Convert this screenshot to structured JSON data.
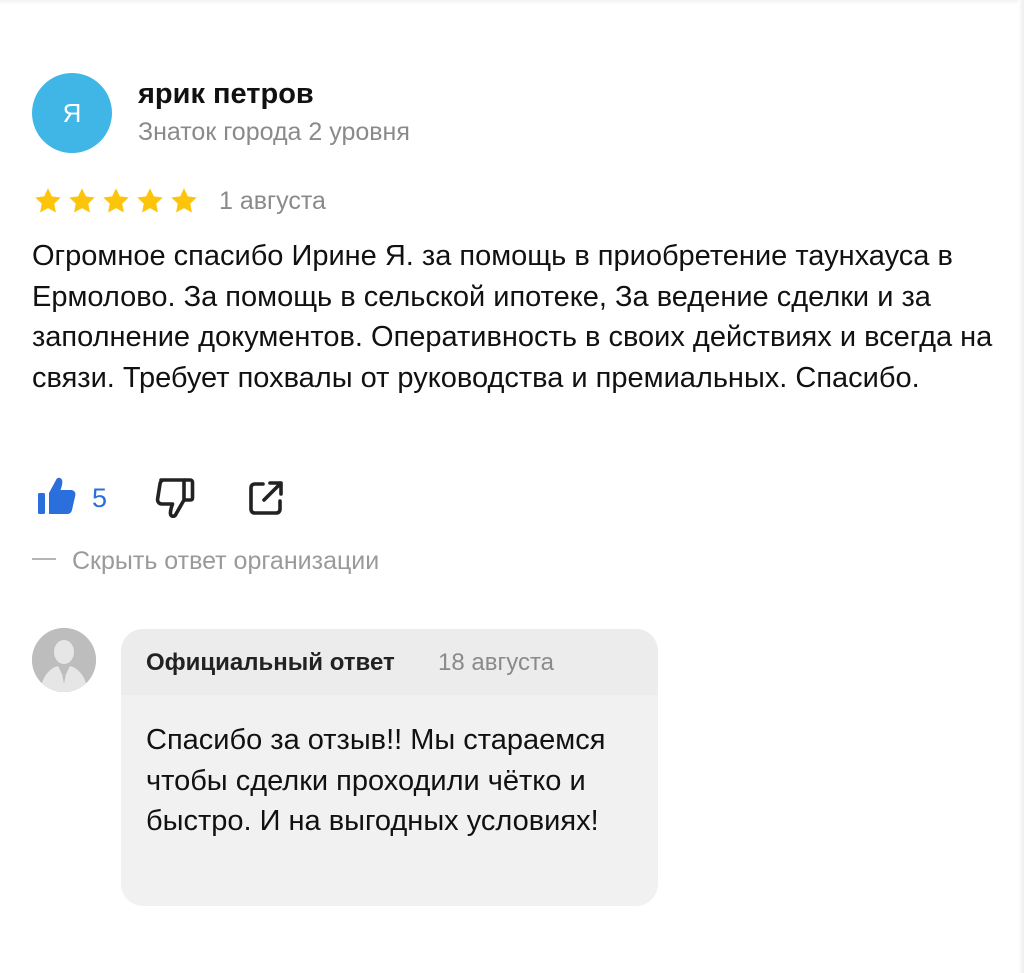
{
  "review": {
    "author": {
      "initial": "Я",
      "name": "ярик петров",
      "level": "Знаток города 2 уровня",
      "avatar_color": "#3fb6e6"
    },
    "rating": 5,
    "star_color": "#fcc50b",
    "date": "1 августа",
    "text": "Огромное спасибо Ирине Я. за помощь в приобретение таунхауса в Ермолово. За помощь в сельской ипотеке, За ведение сделки и за заполнение документов. Оперативность в своих действиях и всегда на связи. Требует похвалы от руководства и премиальных. Спасибо."
  },
  "actions": {
    "like_icon": "thumbs-up-icon",
    "like_count": "5",
    "like_color": "#2a6fdb",
    "dislike_icon": "thumbs-down-icon",
    "share_icon": "share-icon"
  },
  "hide_reply": {
    "label": "Скрыть ответ организации"
  },
  "org_reply": {
    "avatar_icon": "person-silhouette-icon",
    "title": "Официальный ответ",
    "date": "18 августа",
    "text": "Спасибо за отзыв!! Мы стараемся чтобы сделки проходили чётко и быстро. И на выгодных условиях!"
  }
}
